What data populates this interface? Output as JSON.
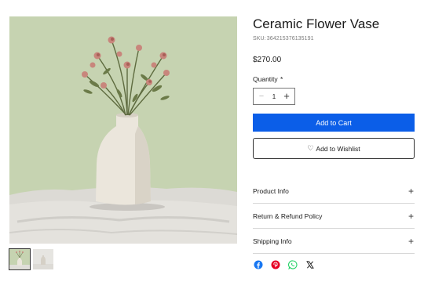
{
  "product": {
    "title": "Ceramic Flower Vase",
    "sku_label": "SKU:",
    "sku": "364215376135191",
    "price": "$270.00"
  },
  "quantity": {
    "label": "Quantity",
    "required_mark": "*",
    "minus": "−",
    "value": "1",
    "plus": "+"
  },
  "buttons": {
    "add_to_cart": "Add to Cart",
    "wishlist_icon": "♡",
    "add_to_wishlist": "Add to Wishlist"
  },
  "accordion": [
    {
      "label": "Product Info",
      "icon": "+"
    },
    {
      "label": "Return & Refund Policy",
      "icon": "+"
    },
    {
      "label": "Shipping Info",
      "icon": "+"
    }
  ],
  "social": {
    "icons": [
      "facebook-icon",
      "pinterest-icon",
      "whatsapp-icon",
      "x-icon"
    ],
    "colors": {
      "facebook": "#1877f2",
      "pinterest": "#e60023",
      "whatsapp": "#25d366",
      "x": "#111111"
    }
  },
  "theme": {
    "accent": "#0b5ee8",
    "image_background": "#c9d6b5"
  },
  "gallery": {
    "thumbnail_count": 2,
    "selected_index": 0
  }
}
